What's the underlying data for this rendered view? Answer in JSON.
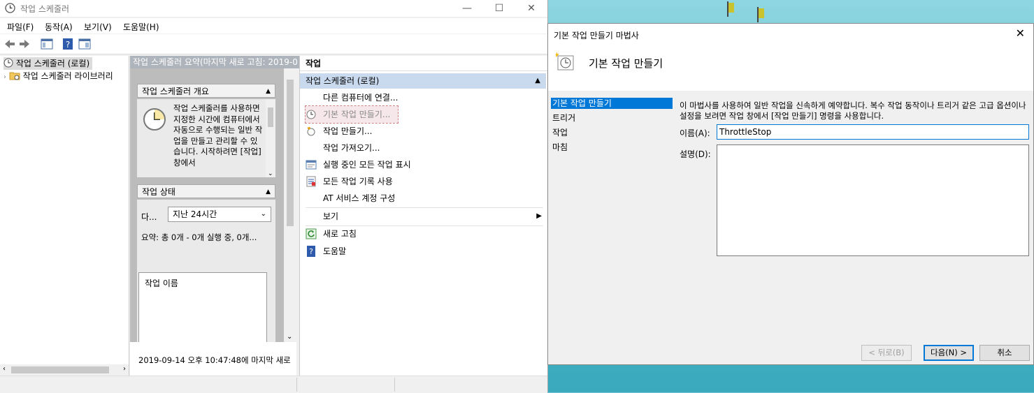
{
  "main_window": {
    "title": "작업 스케줄러",
    "controls": {
      "minimize": "—",
      "maximize": "☐",
      "close": "✕"
    },
    "menu": [
      "파일(F)",
      "동작(A)",
      "보기(V)",
      "도움말(H)"
    ]
  },
  "tree": {
    "items": [
      {
        "label": "작업 스케줄러 (로컬)"
      },
      {
        "label": "작업 스케줄러 라이브러리"
      }
    ]
  },
  "center": {
    "header": "작업 스케줄러 요약(마지막 새로 고침: 2019-0",
    "overview": {
      "title": "작업 스케줄러 개요",
      "text": "작업 스케줄러를 사용하면 지정한 시간에 컴퓨터에서 자동으로 수행되는 일반 작업을 만들고 관리할 수 있습니다. 시작하려면 [작업] 창에서"
    },
    "status": {
      "title": "작업 상태",
      "filter_label": "다...",
      "filter_value": "지난 24시간",
      "summary": "요약: 총 0개 - 0개 실행 중, 0개...",
      "list_header": "작업 이름"
    },
    "footer": "2019-09-14 오후 10:47:48에 마지막 새로"
  },
  "actions": {
    "title": "작업",
    "section": "작업 스케줄러 (로컬)",
    "items": [
      {
        "label": "다른 컴퓨터에 연결...",
        "icon": "none"
      },
      {
        "label": "기본 작업 만들기...",
        "icon": "basic-task-icon"
      },
      {
        "label": "작업 만들기...",
        "icon": "create-task-icon"
      },
      {
        "label": "작업 가져오기...",
        "icon": "none"
      },
      {
        "label": "실행 중인 모든 작업 표시",
        "icon": "running-tasks-icon"
      },
      {
        "label": "모든 작업 기록 사용",
        "icon": "history-icon"
      },
      {
        "label": "AT 서비스 계정 구성",
        "icon": "none"
      },
      {
        "label": "보기",
        "icon": "none"
      },
      {
        "label": "새로 고침",
        "icon": "refresh-icon"
      },
      {
        "label": "도움말",
        "icon": "help-icon"
      }
    ]
  },
  "wizard": {
    "title": "기본 작업 만들기 마법사",
    "heading": "기본 작업 만들기",
    "nav": [
      "기본 작업 만들기",
      "트리거",
      "작업",
      "마침"
    ],
    "description": "이 마법사를 사용하여 일반 작업을 신속하게 예약합니다. 복수 작업 동작이나 트리거 같은 고급 옵션이나 설정을 보려면 작업 창에서 [작업 만들기] 명령을 사용합니다.",
    "name_label": "이름(A):",
    "name_value": "ThrottleStop",
    "desc_label": "설명(D):",
    "desc_value": "",
    "buttons": {
      "back": "< 뒤로(B)",
      "next": "다음(N) >",
      "cancel": "취소"
    }
  },
  "colors": {
    "accent": "#0078d7",
    "selection": "#c9d9ee"
  }
}
